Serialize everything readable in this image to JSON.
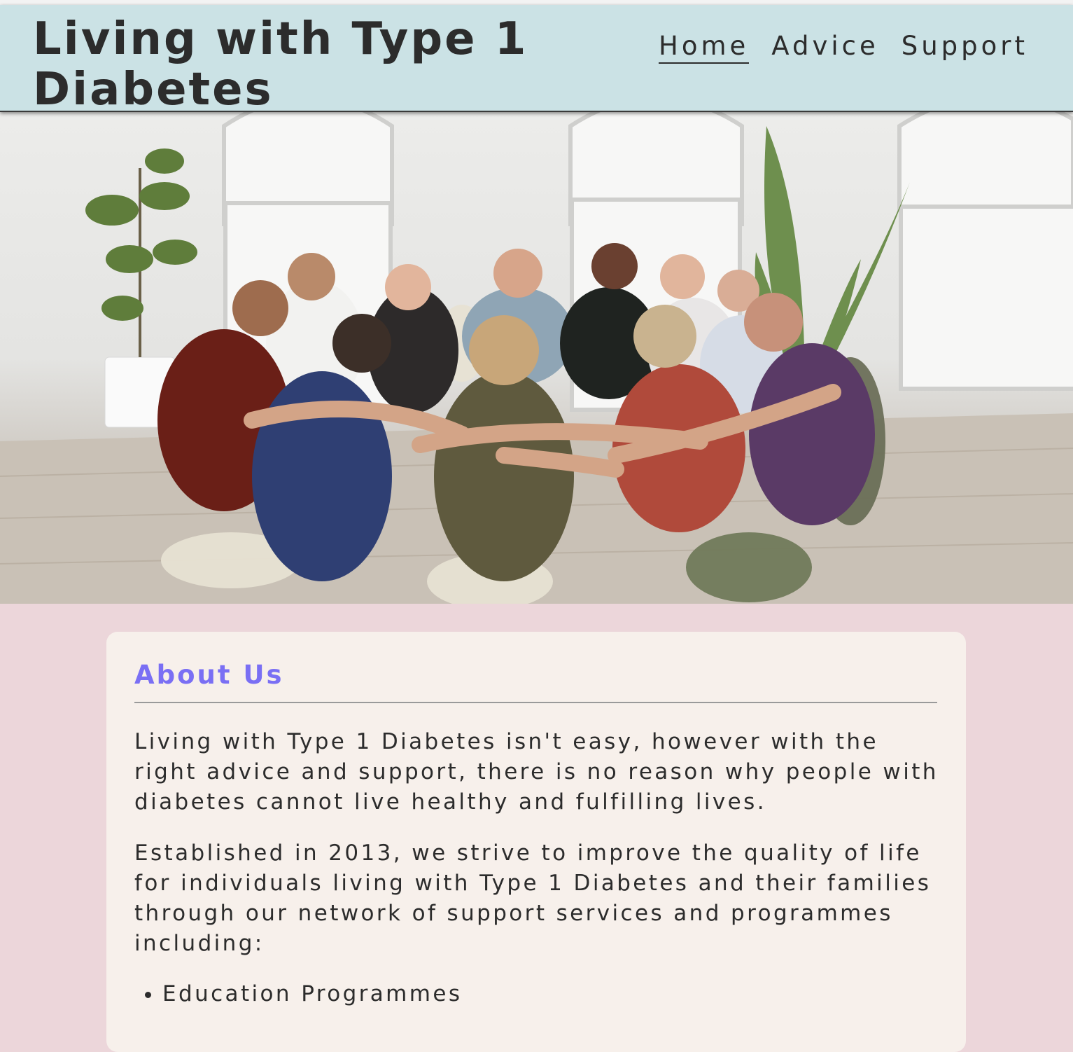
{
  "site": {
    "title": "Living with Type 1 Diabetes"
  },
  "nav": {
    "items": [
      {
        "label": "Home",
        "active": true
      },
      {
        "label": "Advice",
        "active": false
      },
      {
        "label": "Support",
        "active": false
      }
    ]
  },
  "hero": {
    "image": "group-support-circle-photo"
  },
  "about": {
    "heading": "About Us",
    "paragraphs": [
      "Living with Type 1 Diabetes isn't easy, however with the right advice and support, there is no reason why people with diabetes cannot live healthy and fulfilling lives.",
      "Established in 2013, we strive to improve the quality of life for individuals living with Type 1 Diabetes and their families through our network of support services and programmes including:"
    ],
    "list": [
      "Education Programmes"
    ]
  },
  "colors": {
    "header_bg": "#cbe2e5",
    "page_bg": "#ecd6da",
    "card_bg": "#f7f0eb",
    "heading_accent": "#7a6ff4",
    "text": "#2c2c2c"
  }
}
